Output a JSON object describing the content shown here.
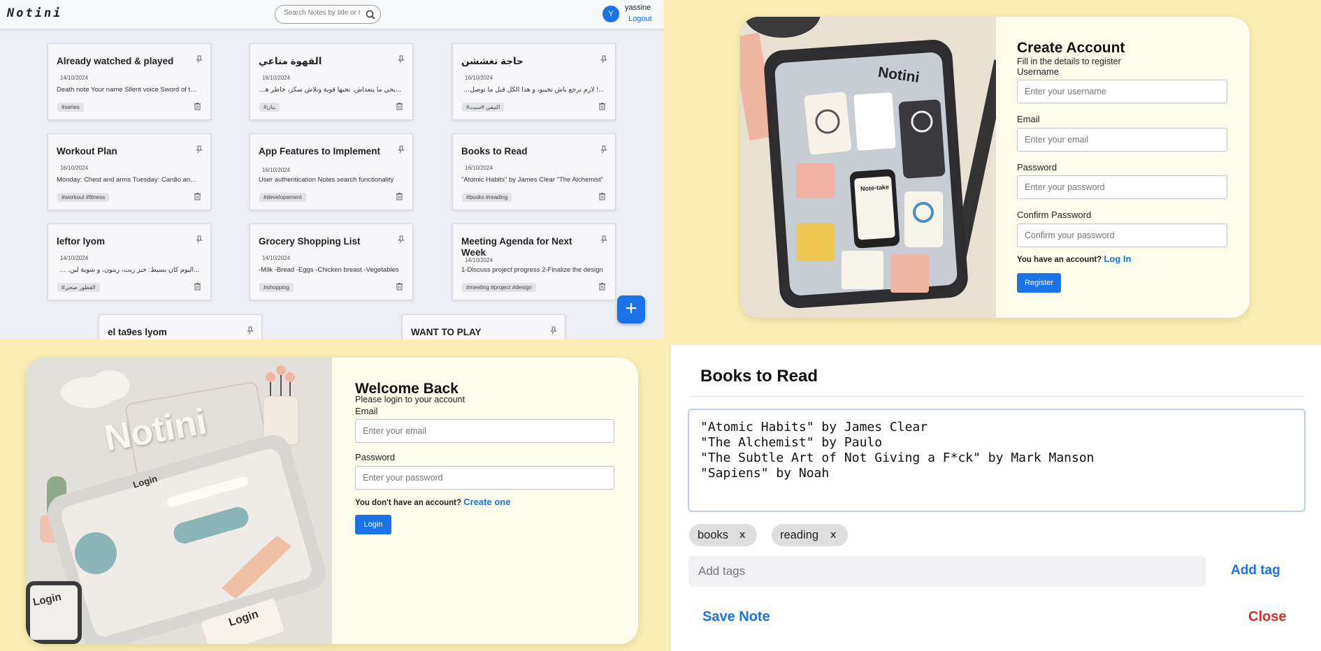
{
  "dashboard": {
    "logo": "Notini",
    "search_placeholder": "Search Notes by title or tags",
    "user": {
      "initial": "Y",
      "name": "yassine",
      "logout": "Logout"
    },
    "add_symbol": "+",
    "notes": [
      {
        "title": "Already watched & played",
        "date": "14/10/2024",
        "body": "Death note Your name Silent voice Sword of the stranger",
        "tags": "#series",
        "rtl": false
      },
      {
        "title": "القهوة متاعي",
        "date": "16/10/2024",
        "body": "...يحي ما يتعداش. نحبها قوية وبلاش سكر، خاطر هكا تخدم المخ",
        "tags": "#بنان",
        "rtl": true
      },
      {
        "title": "حاجة تغششن",
        "date": "16/10/2024",
        "body": "...! لازم نرجع باش نجيبو، و هذا الكل قبل ما نوصل للاجتماع",
        "tags": "#التيفي #سيت",
        "rtl": true
      },
      {
        "title": "Workout Plan",
        "date": "16/10/2024",
        "body": "Monday: Chest and arms Tuesday: Cardio and abs",
        "tags": "#workout #fitness",
        "rtl": false
      },
      {
        "title": "App Features to Implement",
        "date": "16/10/2024",
        "body": "User authentication Notes search functionality",
        "tags": "#developement",
        "rtl": false
      },
      {
        "title": "Books to Read",
        "date": "16/10/2024",
        "body": "\"Atomic Habits\" by James Clear \"The Alchemist\"",
        "tags": "#books #reading",
        "rtl": false
      },
      {
        "title": "leftor lyom",
        "date": "14/10/2024",
        "body": "...اليوم كان بسيط: خبز زيت، زيتون، و شوية لبن. صحي و سريع",
        "tags": "#الفطور صحي",
        "rtl": true
      },
      {
        "title": "Grocery Shopping List",
        "date": "14/10/2024",
        "body": "-Milk -Bread -Eggs -Chicken breast -Vegetables",
        "tags": "#shopping",
        "rtl": false
      },
      {
        "title": "Meeting Agenda for Next Week",
        "date": "14/10/2024",
        "body": "1-Discuss project progress 2-Finalize the design",
        "tags": "#meeting #project #design",
        "rtl": false
      },
      {
        "title": "el ta9es lyom",
        "date": "",
        "body": "",
        "tags": "",
        "rtl": false
      },
      {
        "title": "WANT TO PLAY",
        "date": "",
        "body": "",
        "tags": "",
        "rtl": false
      }
    ]
  },
  "register": {
    "title": "Create Account",
    "subtitle": "Fill in the details to register",
    "username_label": "Username",
    "username_placeholder": "Enter your username",
    "email_label": "Email",
    "email_placeholder": "Enter your email",
    "password_label": "Password",
    "password_placeholder": "Enter your password",
    "confirm_label": "Confirm Password",
    "confirm_placeholder": "Confirm your password",
    "have_account": "You have an account?",
    "login_link": "Log In",
    "register_button": "Register",
    "illustration_brand": "Notini",
    "illustration_phone_text": "Note-take"
  },
  "login": {
    "title": "Welcome Back",
    "subtitle": "Please login to your account",
    "email_label": "Email",
    "email_placeholder": "Enter your email",
    "password_label": "Password",
    "password_placeholder": "Enter your password",
    "no_account": "You don't have an account?",
    "create_link": "Create one",
    "login_button": "Login",
    "illustration_brand": "Notini",
    "illustration_login_word": "Login"
  },
  "editor": {
    "title": "Books to Read",
    "content": "\"Atomic Habits\" by James Clear\n\"The Alchemist\" by Paulo\n\"The Subtle Art of Not Giving a F*ck\" by Mark Manson\n\"Sapiens\" by Noah",
    "tags": [
      "books",
      "reading"
    ],
    "remove_symbol": "x",
    "tag_placeholder": "Add tags",
    "add_tag": "Add tag",
    "save": "Save Note",
    "close": "Close"
  },
  "colors": {
    "accent": "#1a73e8",
    "danger": "#d93025",
    "backdrop": "#fbeeb4",
    "card": "#fdfbeb"
  }
}
